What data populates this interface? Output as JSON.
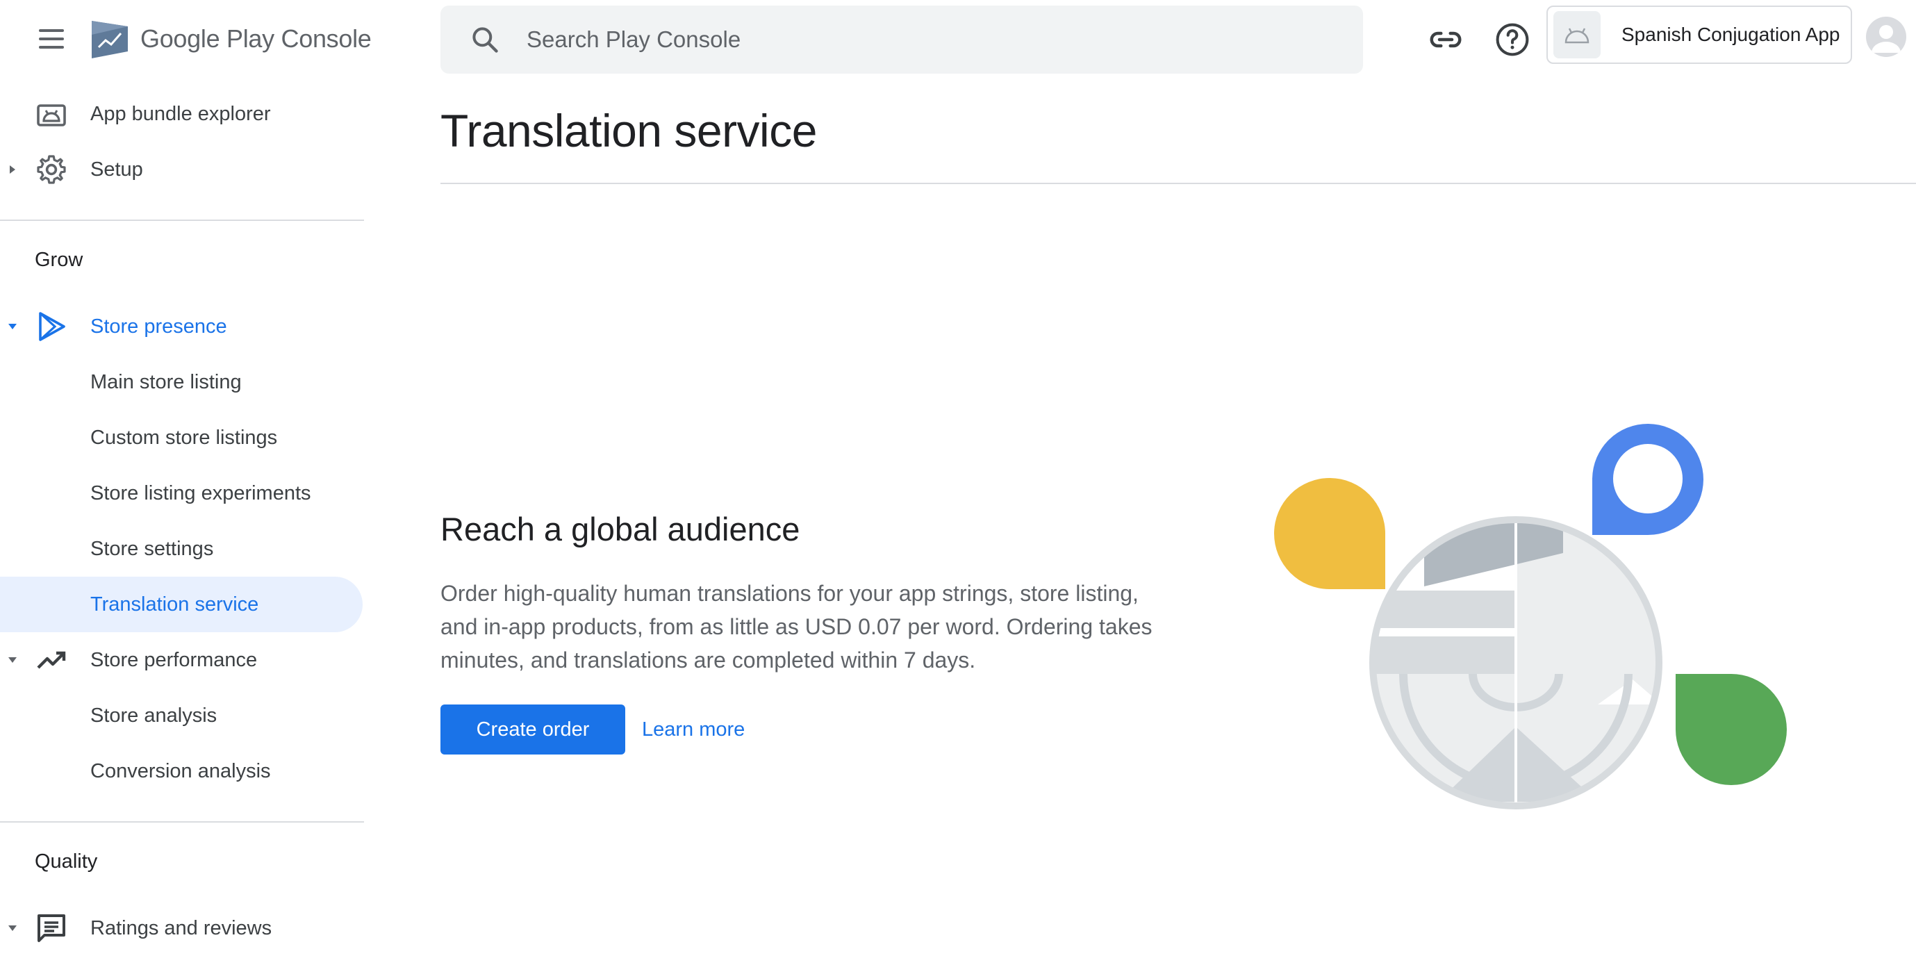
{
  "header": {
    "logo_text_google_play": "Google Play",
    "logo_text_console": "Console",
    "search_placeholder": "Search Play Console",
    "app_name": "Spanish Conjugation App"
  },
  "sidebar": {
    "items_top": [
      {
        "label": "App bundle explorer"
      },
      {
        "label": "Setup"
      }
    ],
    "sections": [
      {
        "title": "Grow"
      },
      {
        "title": "Quality"
      }
    ],
    "store_presence": {
      "label": "Store presence",
      "children": [
        {
          "label": "Main store listing"
        },
        {
          "label": "Custom store listings"
        },
        {
          "label": "Store listing experiments"
        },
        {
          "label": "Store settings"
        },
        {
          "label": "Translation service"
        }
      ]
    },
    "store_performance": {
      "label": "Store performance",
      "children": [
        {
          "label": "Store analysis"
        },
        {
          "label": "Conversion analysis"
        }
      ]
    },
    "ratings": {
      "label": "Ratings and reviews"
    }
  },
  "main": {
    "title": "Translation service",
    "hero_heading": "Reach a global audience",
    "hero_body": "Order high-quality human translations for your app strings, store listing, and in-app products, from as little as USD 0.07 per word. Ordering takes minutes, and translations are completed within 7 days.",
    "create_order_label": "Create order",
    "learn_more_label": "Learn more"
  },
  "colors": {
    "accent": "#1a73e8",
    "active_bg": "#e8f0fe",
    "yellow": "#f0be40",
    "blue": "#4f86ec",
    "green": "#58a857"
  }
}
